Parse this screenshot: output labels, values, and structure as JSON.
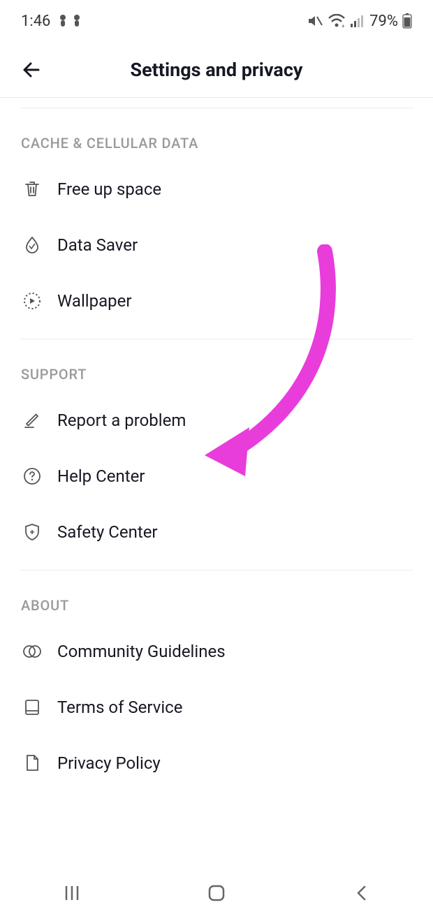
{
  "status": {
    "time": "1:46",
    "battery_pct": "79%"
  },
  "header": {
    "title": "Settings and privacy"
  },
  "sections": {
    "cache": {
      "title": "CACHE & CELLULAR DATA",
      "items": {
        "free_up": "Free up space",
        "data_saver": "Data Saver",
        "wallpaper": "Wallpaper"
      }
    },
    "support": {
      "title": "SUPPORT",
      "items": {
        "report": "Report a problem",
        "help": "Help Center",
        "safety": "Safety Center"
      }
    },
    "about": {
      "title": "ABOUT",
      "items": {
        "community": "Community Guidelines",
        "terms": "Terms of Service",
        "privacy": "Privacy Policy"
      }
    }
  },
  "annotation": {
    "color": "#E83DDB"
  }
}
